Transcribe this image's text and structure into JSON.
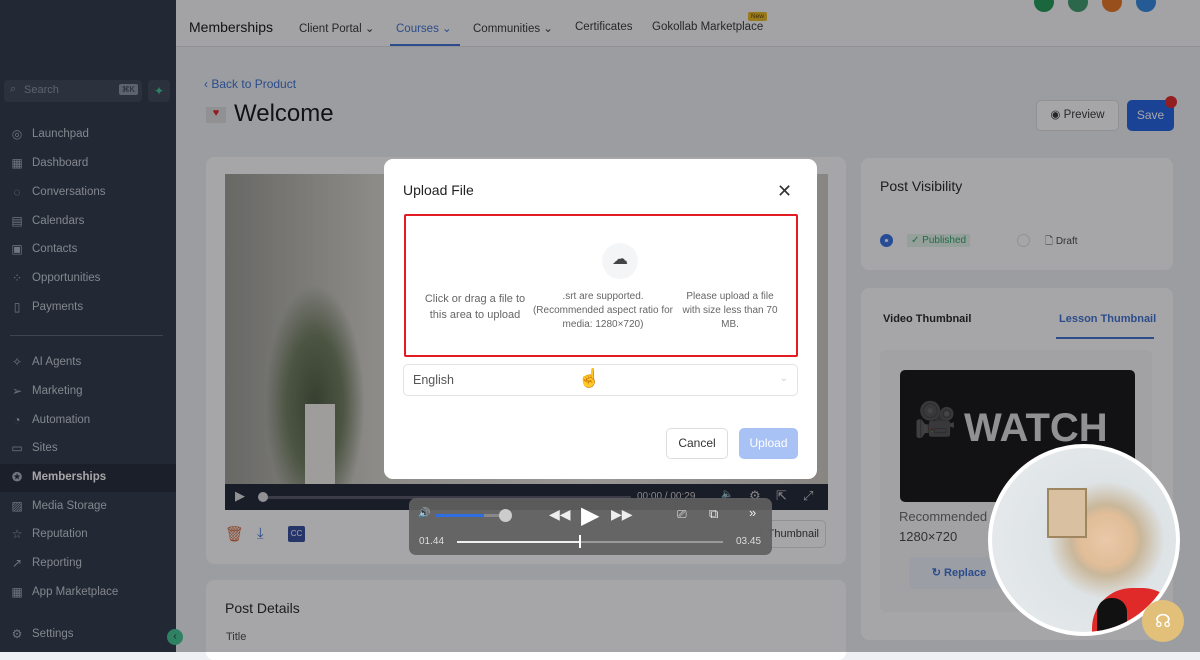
{
  "sidebar": {
    "search_placeholder": "Search",
    "shortcut": "⌘K",
    "items": [
      {
        "label": "Launchpad",
        "icon": "launchpad-icon"
      },
      {
        "label": "Dashboard",
        "icon": "dashboard-icon"
      },
      {
        "label": "Conversations",
        "icon": "chat-icon"
      },
      {
        "label": "Calendars",
        "icon": "calendar-icon"
      },
      {
        "label": "Contacts",
        "icon": "contacts-icon"
      },
      {
        "label": "Opportunities",
        "icon": "opportunities-icon"
      },
      {
        "label": "Payments",
        "icon": "payments-icon"
      },
      {
        "label": "AI Agents",
        "icon": "sparkle-icon"
      },
      {
        "label": "Marketing",
        "icon": "send-icon"
      },
      {
        "label": "Automation",
        "icon": "automation-icon"
      },
      {
        "label": "Sites",
        "icon": "sites-icon"
      },
      {
        "label": "Memberships",
        "icon": "award-icon",
        "active": true
      },
      {
        "label": "Media Storage",
        "icon": "image-icon"
      },
      {
        "label": "Reputation",
        "icon": "star-icon"
      },
      {
        "label": "Reporting",
        "icon": "trend-icon"
      },
      {
        "label": "App Marketplace",
        "icon": "grid-icon"
      },
      {
        "label": "Settings",
        "icon": "gear-icon"
      }
    ]
  },
  "topbar": {
    "title": "Memberships",
    "tabs": [
      "Client Portal",
      "Courses",
      "Communities",
      "Certificates",
      "Gokollab Marketplace"
    ],
    "new_badge": "New"
  },
  "page": {
    "back": "Back to Product",
    "title": "Welcome",
    "preview": "Preview",
    "save": "Save"
  },
  "video": {
    "time": "00:00 / 00:29"
  },
  "thumbnail_button": "Thumbnail",
  "post_details": {
    "title": "Post Details",
    "field_title": "Title"
  },
  "visibility": {
    "title": "Post Visibility",
    "published": "Published",
    "draft": "Draft"
  },
  "thumb_card": {
    "tabs": [
      "Video Thumbnail",
      "Lesson Thumbnail"
    ],
    "image_text": "WATCH",
    "recommended": "Recommended",
    "size": "1280×720",
    "replace": "Replace"
  },
  "modal": {
    "title": "Upload File",
    "drop_main": "Click or drag a file to this area to upload",
    "drop_formats": ".srt are supported. (Recommended aspect ratio for media: 1280×720)",
    "drop_size": "Please upload a file with size less than 70 MB.",
    "language": "English",
    "cancel": "Cancel",
    "upload": "Upload"
  },
  "player": {
    "current": "01.44",
    "total": "03.45",
    "progress": 0.46,
    "volume": 0.75
  }
}
